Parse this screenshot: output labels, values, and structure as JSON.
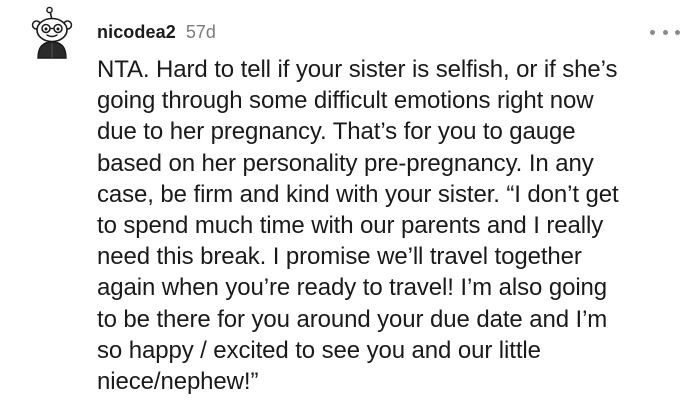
{
  "comment": {
    "author": "nicodea2",
    "age": "57d",
    "avatar_icon": "snoo-avatar-icon",
    "more_icon": "more-options-icon",
    "body_lines": [
      "NTA. Hard to tell if your sister is selfish, or if she’s",
      "going through some difficult emotions right now",
      "due to her pregnancy. That’s for you to gauge",
      "based on her personality pre-pregnancy. In any",
      "case, be firm and kind with your sister. “I don’t get",
      "to spend much time with our parents and I really",
      "need this break. I promise we’ll travel together",
      "again when you’re ready to travel! I’m also going",
      "to be there for you around your due date and I’m",
      "so happy / excited to see you and our little",
      "niece/nephew!”"
    ]
  }
}
